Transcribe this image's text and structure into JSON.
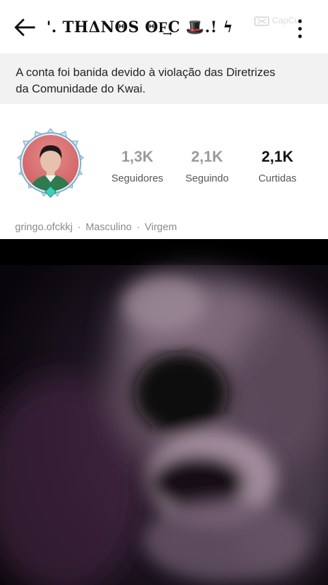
{
  "header": {
    "title": "'. THΔNΘS ΘF͢C 🎩.! ϟ",
    "watermark": "CapCut",
    "back_icon": "arrow-left-icon",
    "more_icon": "more-vertical-icon"
  },
  "banner": {
    "text": "A conta foi banida devido à violação das Diretrizes da Comunidade do Kwai."
  },
  "profile": {
    "stats": [
      {
        "value": "1,3K",
        "label": "Seguidores"
      },
      {
        "value": "2,1K",
        "label": "Seguindo"
      },
      {
        "value": "2,1K",
        "label": "Curtidas"
      }
    ],
    "meta": [
      "gringo.ofckkj",
      "Masculino",
      "Virgem"
    ],
    "meta_separator": "·"
  },
  "colors": {
    "banner_bg": "#f2f2f2",
    "stat_gray": "#9a9a9a",
    "video_bg": "#000000"
  }
}
